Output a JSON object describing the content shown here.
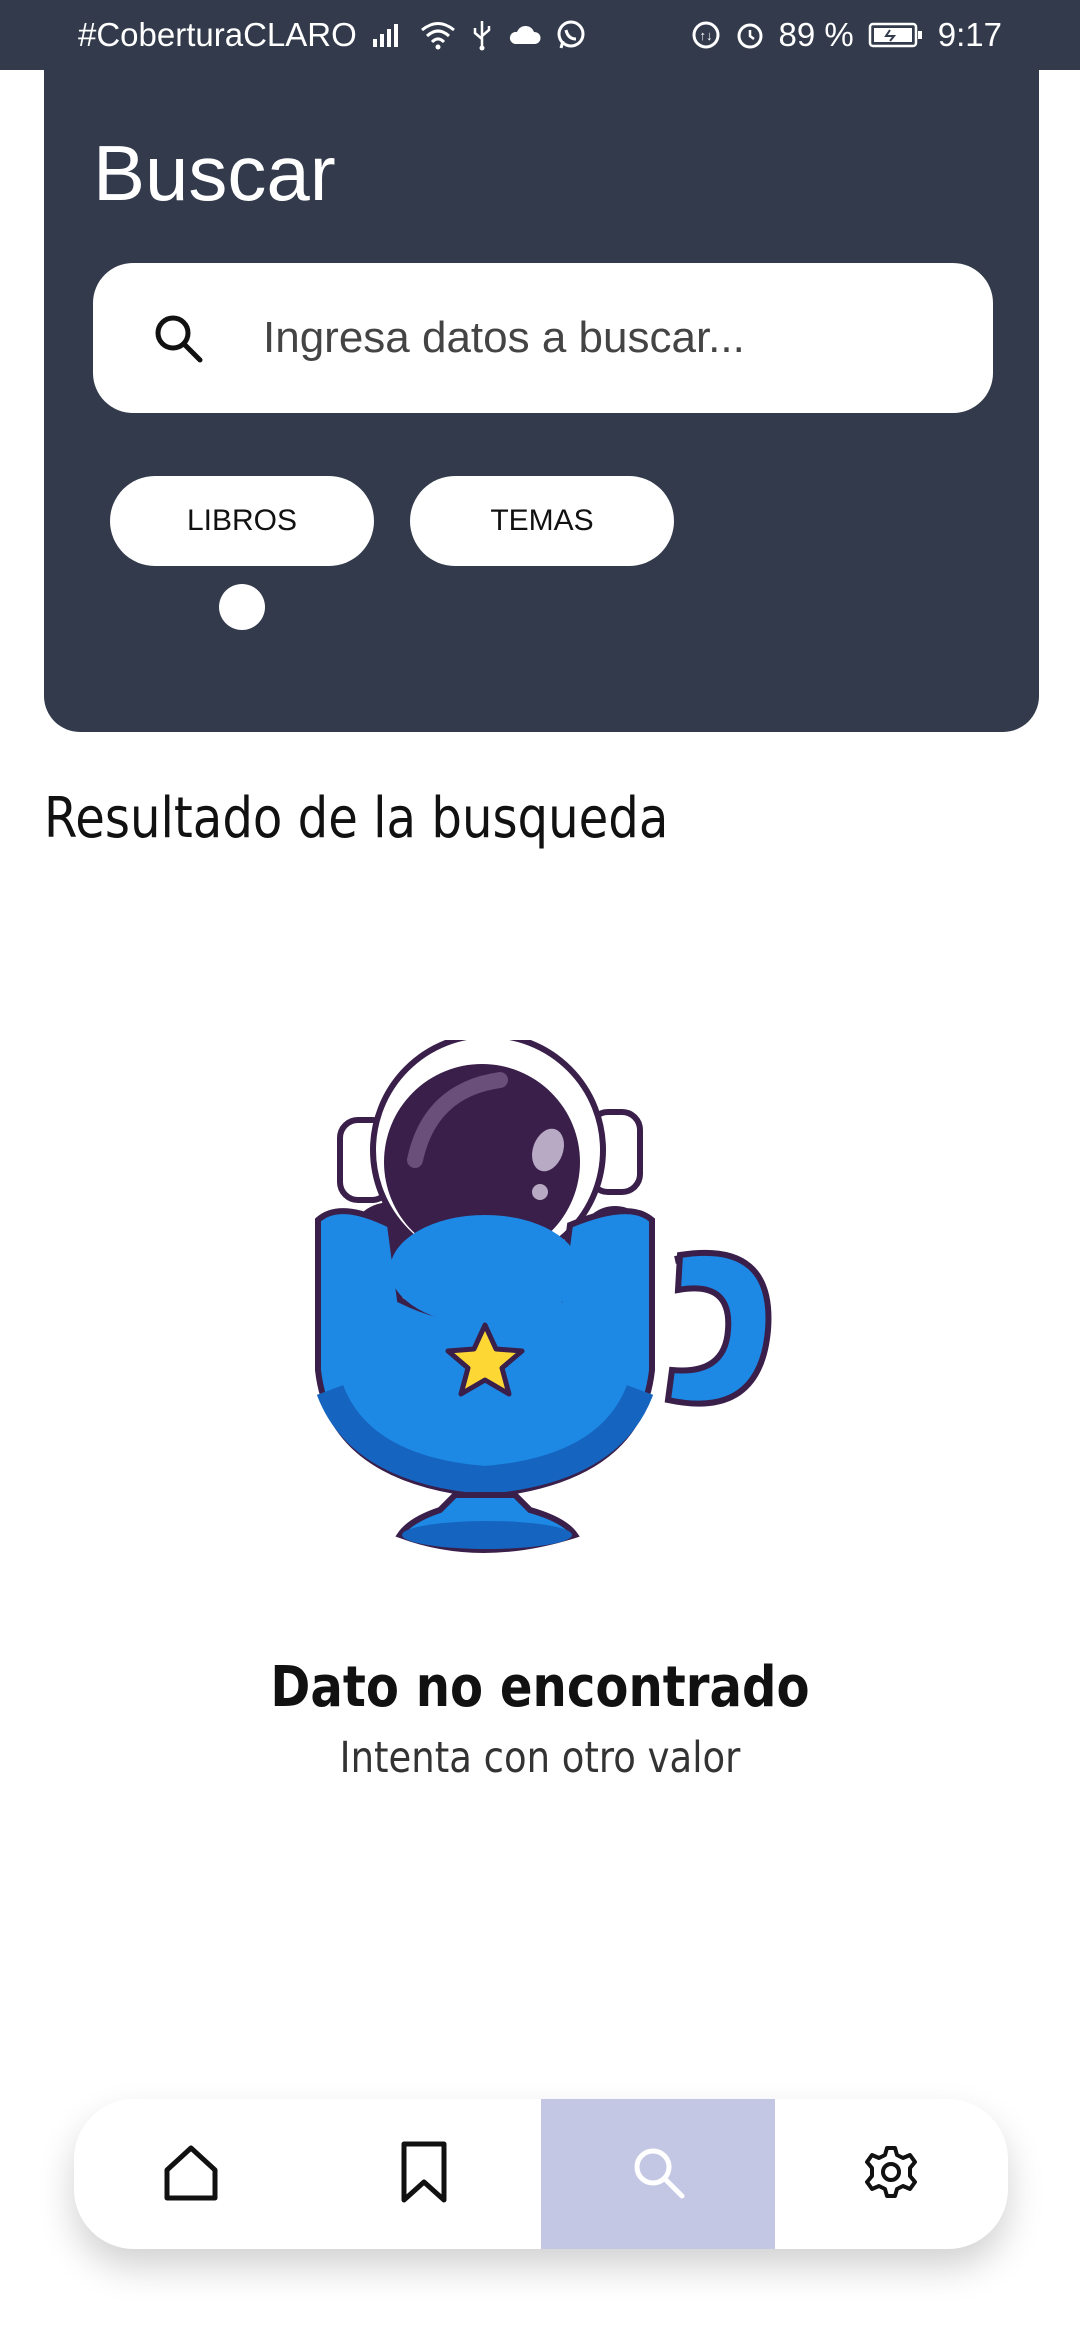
{
  "status_bar": {
    "carrier": "#CoberturaCLARO",
    "battery": "89 %",
    "time": "9:17",
    "icons": [
      "signal-icon",
      "wifi-icon",
      "usb-icon",
      "cloud-icon",
      "whatsapp-icon",
      "data-saver-icon",
      "alarm-icon",
      "battery-icon"
    ]
  },
  "header": {
    "title": "Buscar",
    "search": {
      "placeholder": "Ingresa datos a buscar...",
      "value": "",
      "icon": "search-icon"
    },
    "filters": [
      {
        "label": "LIBROS",
        "selected": true
      },
      {
        "label": "TEMAS",
        "selected": false
      }
    ]
  },
  "results": {
    "title": "Resultado de la busqueda",
    "empty_state": {
      "illustration": "astronaut-in-cup-illustration",
      "title": "Dato no encontrado",
      "subtitle": "Intenta con otro valor"
    }
  },
  "bottom_nav": {
    "items": [
      {
        "icon": "home-icon",
        "active": false
      },
      {
        "icon": "bookmark-icon",
        "active": false
      },
      {
        "icon": "search-icon",
        "active": true
      },
      {
        "icon": "gear-icon",
        "active": false
      }
    ]
  },
  "colors": {
    "header_bg": "#323a4b",
    "nav_active_bg": "#c4c7e4",
    "nav_active_icon": "#ffffff",
    "cup_blue": "#1e88e5",
    "helmet_purple": "#3a1f4a",
    "star_yellow": "#fdd835"
  }
}
